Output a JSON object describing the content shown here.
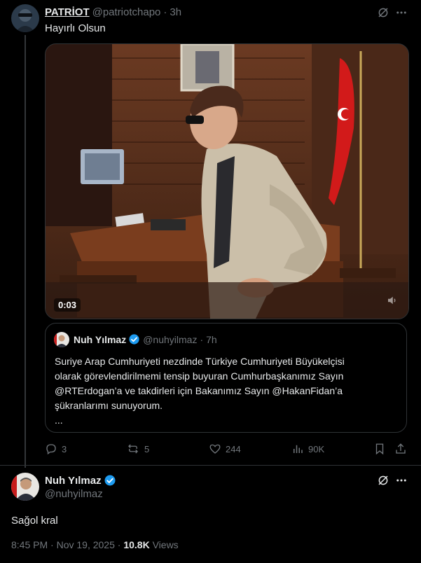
{
  "tweet": {
    "author_name": "PATRİOT",
    "author_handle": "@patriotchapo",
    "separator": "·",
    "time": "3h",
    "text": "Hayırlı Olsun",
    "video": {
      "timestamp": "0:03"
    },
    "quote": {
      "author_name": "Nuh Yılmaz",
      "author_handle": "@nuhyilmaz",
      "separator": "·",
      "time": "7h",
      "text_lines": [
        "Suriye Arap Cumhuriyeti nezdinde Türkiye Cumhuriyeti Büyükelçisi",
        "olarak görevlendirilmemi tensip buyuran Cumhurbaşkanımız Sayın",
        "@RTErdogan’a ve takdirleri için Bakanımız Sayın @HakanFidan’a",
        "şükranlarımı sunuyorum."
      ],
      "more": "..."
    },
    "stats": {
      "replies": "3",
      "reposts": "5",
      "likes": "244",
      "views": "90K"
    }
  },
  "reply": {
    "author_name": "Nuh Yılmaz",
    "author_handle": "@nuhyilmaz",
    "text": "Sağol kral",
    "time": "8:45 PM",
    "date": "Nov 19, 2025",
    "separator": "·",
    "views_count": "10.8K",
    "views_label": "Views"
  },
  "icons": [
    "grok-icon",
    "more-icon",
    "verified-icon",
    "reply-icon",
    "repost-icon",
    "like-icon",
    "views-icon",
    "bookmark-icon",
    "share-icon",
    "volume-icon"
  ],
  "colors": {
    "background": "#000000",
    "text": "#e7e9ea",
    "muted": "#71767b",
    "border": "#2f3336",
    "verified": "#1d9bf0"
  }
}
